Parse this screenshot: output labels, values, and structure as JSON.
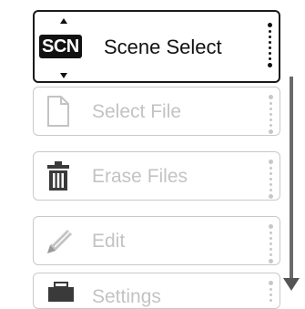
{
  "menu": {
    "selected": {
      "badge": "SCN",
      "label": "Scene Select"
    },
    "items": [
      {
        "label": "Select File",
        "icon": "file-icon"
      },
      {
        "label": "Erase Files",
        "icon": "trash-icon"
      },
      {
        "label": "Edit",
        "icon": "pencil-icon"
      },
      {
        "label": "Settings",
        "icon": "toolbox-icon"
      }
    ]
  },
  "colors": {
    "selected_border": "#1a1a1a",
    "dim_border": "#c9c9c9",
    "dim_text": "#c3c3c3",
    "scrollbar": "#6a6a6a"
  }
}
